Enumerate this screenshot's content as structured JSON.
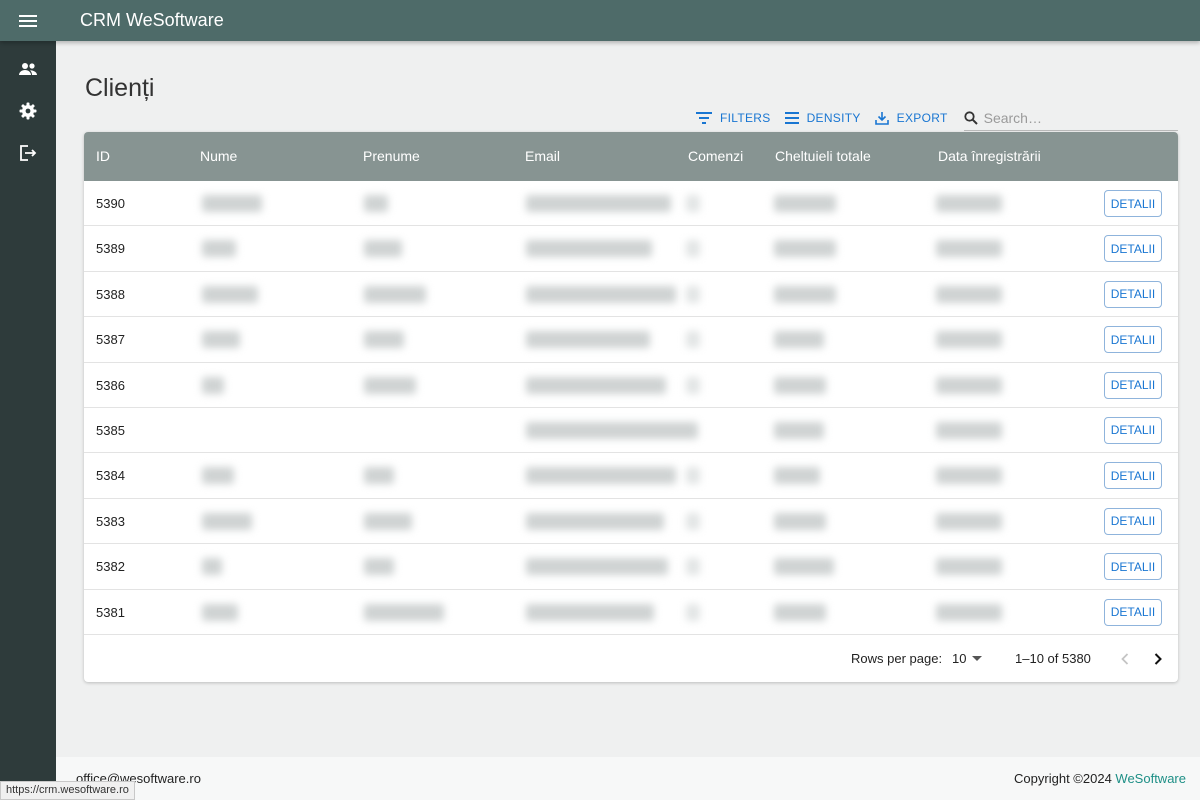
{
  "app": {
    "title": "CRM WeSoftware"
  },
  "sidebar": {
    "items": [
      {
        "icon": "people-icon"
      },
      {
        "icon": "gear-icon"
      },
      {
        "icon": "logout-icon"
      }
    ]
  },
  "page": {
    "title": "Clienți"
  },
  "toolbar": {
    "filters_label": "FILTERS",
    "density_label": "DENSITY",
    "export_label": "EXPORT",
    "search_placeholder": "Search…"
  },
  "table": {
    "columns": [
      "ID",
      "Nume",
      "Prenume",
      "Email",
      "Comenzi",
      "Cheltuieli totale",
      "Data înregistrării"
    ],
    "details_label": "DETALII",
    "rows": [
      {
        "id": "5390"
      },
      {
        "id": "5389"
      },
      {
        "id": "5388"
      },
      {
        "id": "5387"
      },
      {
        "id": "5386"
      },
      {
        "id": "5385"
      },
      {
        "id": "5384"
      },
      {
        "id": "5383"
      },
      {
        "id": "5382"
      },
      {
        "id": "5381"
      }
    ]
  },
  "pagination": {
    "rows_per_page_label": "Rows per page:",
    "rows_per_page_value": "10",
    "range_label": "1–10 of 5380"
  },
  "footer": {
    "email": "office@wesoftware.ro",
    "copyright_prefix": "Copyright ©2024",
    "copyright_link": "WeSoftware"
  },
  "status_bar": {
    "url": "https://crm.wesoftware.ro"
  },
  "colors": {
    "appbar": "#4e6b69",
    "sidebar": "#2e3b3b",
    "table_header": "#879492",
    "accent": "#1976d2",
    "link": "#1e8f86"
  }
}
